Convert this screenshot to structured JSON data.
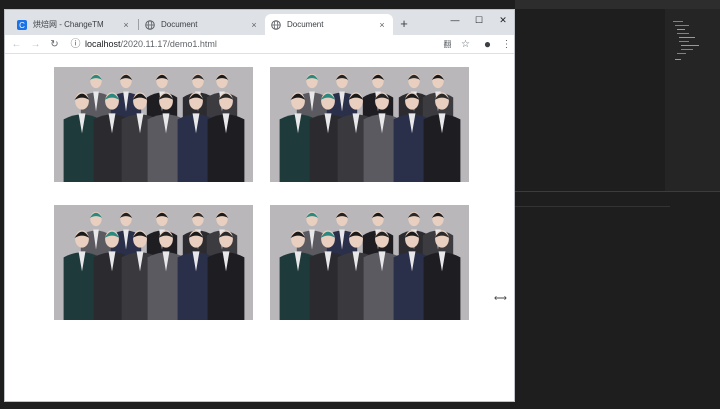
{
  "browser": {
    "tabs": [
      {
        "title": "烘焙网 - ChangeTM",
        "icon": "brand-logo-icon",
        "close": "×"
      },
      {
        "title": "Document",
        "icon": "globe-icon",
        "close": "×"
      },
      {
        "title": "Document",
        "icon": "globe-icon",
        "close": "×",
        "active": true
      }
    ],
    "new_tab": "+",
    "window_controls": {
      "minimize": "—",
      "maximize": "☐",
      "close": "✕"
    },
    "toolbar": {
      "back": "←",
      "forward": "→",
      "reload": "↻",
      "info": "ⓘ",
      "url_host": "localhost",
      "url_path": "/2020.11.17/demo1.html",
      "translate": "翻",
      "bookmark": "☆",
      "profile": "●",
      "menu": "⋮"
    }
  },
  "content": {
    "images": [
      {
        "name": "group-photo-1"
      },
      {
        "name": "group-photo-2"
      },
      {
        "name": "group-photo-3"
      },
      {
        "name": "group-photo-4"
      }
    ]
  },
  "cursor_glyph": "⟷",
  "colors": {
    "tabstrip": "#dee1e6",
    "editor_bg": "#1e1e1e",
    "brand": "#1a73e8"
  }
}
